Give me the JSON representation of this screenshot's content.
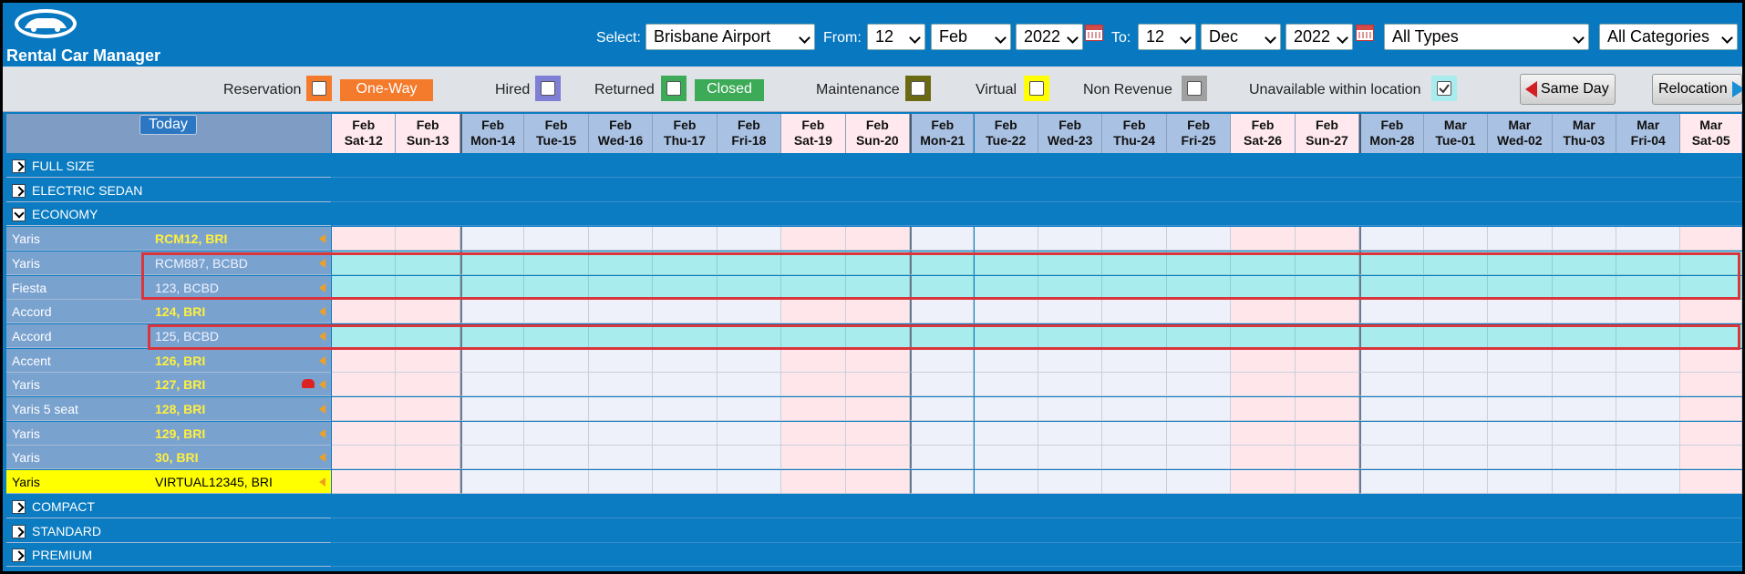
{
  "header": {
    "app_title": "Rental Car Manager",
    "select_label": "Select:",
    "location": "Brisbane Airport",
    "from_label": "From:",
    "from_day": "12",
    "from_month": "Feb",
    "from_year": "2022",
    "to_label": "To:",
    "to_day": "12",
    "to_month": "Dec",
    "to_year": "2022",
    "type_filter": "All Types",
    "category_filter": "All Categories"
  },
  "legend": {
    "reservation": "Reservation",
    "one_way": "One-Way",
    "hired": "Hired",
    "returned": "Returned",
    "closed": "Closed",
    "maintenance": "Maintenance",
    "virtual": "Virtual",
    "non_revenue": "Non Revenue",
    "unavailable": "Unavailable within location",
    "same_day_btn": "Same Day",
    "relocation_btn": "Relocation",
    "colors": {
      "reservation": "#f47a2c",
      "hired": "#7f7fd6",
      "returned": "#3caa56",
      "maintenance": "#6b6a12",
      "virtual": "#ffff00",
      "non_revenue": "#a0a0a0",
      "unavailable": "#a8eced"
    }
  },
  "grid": {
    "today_label": "Today",
    "days": [
      {
        "m": "Feb",
        "d": "Sat-12",
        "we": true
      },
      {
        "m": "Feb",
        "d": "Sun-13",
        "we": true
      },
      {
        "m": "Feb",
        "d": "Mon-14",
        "we": false
      },
      {
        "m": "Feb",
        "d": "Tue-15",
        "we": false
      },
      {
        "m": "Feb",
        "d": "Wed-16",
        "we": false
      },
      {
        "m": "Feb",
        "d": "Thu-17",
        "we": false
      },
      {
        "m": "Feb",
        "d": "Fri-18",
        "we": false
      },
      {
        "m": "Feb",
        "d": "Sat-19",
        "we": true
      },
      {
        "m": "Feb",
        "d": "Sun-20",
        "we": true
      },
      {
        "m": "Feb",
        "d": "Mon-21",
        "we": false
      },
      {
        "m": "Feb",
        "d": "Tue-22",
        "we": false
      },
      {
        "m": "Feb",
        "d": "Wed-23",
        "we": false
      },
      {
        "m": "Feb",
        "d": "Thu-24",
        "we": false
      },
      {
        "m": "Feb",
        "d": "Fri-25",
        "we": false
      },
      {
        "m": "Feb",
        "d": "Sat-26",
        "we": true
      },
      {
        "m": "Feb",
        "d": "Sun-27",
        "we": true
      },
      {
        "m": "Feb",
        "d": "Mon-28",
        "we": false
      },
      {
        "m": "Mar",
        "d": "Tue-01",
        "we": false
      },
      {
        "m": "Mar",
        "d": "Wed-02",
        "we": false
      },
      {
        "m": "Mar",
        "d": "Thu-03",
        "we": false
      },
      {
        "m": "Mar",
        "d": "Fri-04",
        "we": false
      },
      {
        "m": "Mar",
        "d": "Sat-05",
        "we": true
      }
    ],
    "rows": [
      {
        "kind": "cat",
        "name": "FULL SIZE",
        "expanded": false
      },
      {
        "kind": "cat",
        "name": "ELECTRIC SEDAN",
        "expanded": false
      },
      {
        "kind": "cat",
        "name": "ECONOMY",
        "expanded": true
      },
      {
        "kind": "car",
        "model": "Yaris",
        "plate": "RCM12, BRI"
      },
      {
        "kind": "car",
        "model": "Yaris",
        "plate": "RCM887, BCBD",
        "unavailable": true,
        "highlight": true
      },
      {
        "kind": "car",
        "model": "Fiesta",
        "plate": "123, BCBD",
        "unavailable": true,
        "highlight": true
      },
      {
        "kind": "car",
        "model": "Accord",
        "plate": "124, BRI"
      },
      {
        "kind": "car",
        "model": "Accord",
        "plate": "125, BCBD",
        "unavailable": true,
        "highlight": true
      },
      {
        "kind": "car",
        "model": "Accent",
        "plate": "126, BRI"
      },
      {
        "kind": "car",
        "model": "Yaris",
        "plate": "127, BRI",
        "car_icon": true
      },
      {
        "kind": "car",
        "model": "Yaris 5 seat",
        "plate": "128, BRI"
      },
      {
        "kind": "car",
        "model": "Yaris",
        "plate": "129, BRI"
      },
      {
        "kind": "car",
        "model": "Yaris",
        "plate": "30, BRI"
      },
      {
        "kind": "car",
        "model": "Yaris",
        "plate": "VIRTUAL12345, BRI",
        "virtual": true
      },
      {
        "kind": "cat",
        "name": "COMPACT",
        "expanded": false
      },
      {
        "kind": "cat",
        "name": "STANDARD",
        "expanded": false
      },
      {
        "kind": "cat",
        "name": "PREMIUM",
        "expanded": false
      }
    ]
  }
}
